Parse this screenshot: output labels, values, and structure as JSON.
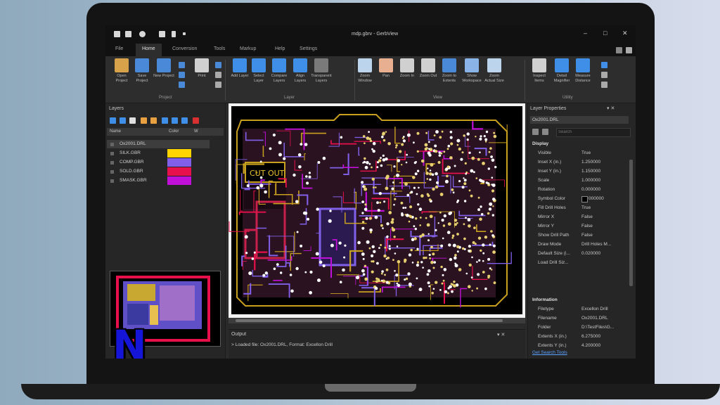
{
  "app": {
    "title": "mdp.gbrv - GerbView",
    "window_controls": [
      "–",
      "□",
      "✕"
    ]
  },
  "menu": {
    "items": [
      "File",
      "Home",
      "Conversion",
      "Tools",
      "Markup",
      "Help",
      "Settings"
    ],
    "active": "Home"
  },
  "ribbon": {
    "buttons": [
      {
        "label": "Open Project",
        "icon": "folder-open-icon",
        "color": "#d8a24a"
      },
      {
        "label": "Save Project",
        "icon": "save-icon",
        "color": "#4a88d8"
      },
      {
        "label": "New Project",
        "icon": "new-project-icon",
        "color": "#4a88d8"
      },
      {
        "label": "Print",
        "icon": "printer-icon",
        "color": "#d0d0d0"
      },
      {
        "label": "Add Layer",
        "icon": "add-layer-icon",
        "color": "#3f8ee8"
      },
      {
        "label": "Select Layer",
        "icon": "cursor-icon",
        "color": "#3f8ee8"
      },
      {
        "label": "Compare Layers",
        "icon": "compare-layers-icon",
        "color": "#3f8ee8"
      },
      {
        "label": "Align Layers",
        "icon": "align-layers-icon",
        "color": "#3f8ee8"
      },
      {
        "label": "Transparent Layers",
        "icon": "transparent-icon",
        "color": "#7a7a7a"
      },
      {
        "label": "Zoom Window",
        "icon": "zoom-window-icon",
        "color": "#bcd4ec"
      },
      {
        "label": "Pan",
        "icon": "hand-icon",
        "color": "#e8b090"
      },
      {
        "label": "Zoom In",
        "icon": "zoom-in-icon",
        "color": "#d0d0d0"
      },
      {
        "label": "Zoom Out",
        "icon": "zoom-out-icon",
        "color": "#d0d0d0"
      },
      {
        "label": "Zoom to Extents",
        "icon": "zoom-extents-icon",
        "color": "#4a88d8"
      },
      {
        "label": "Show Workspace",
        "icon": "grid-icon",
        "color": "#8ab4e8"
      },
      {
        "label": "Zoom Actual Size",
        "icon": "actual-size-icon",
        "color": "#bcd4ec"
      },
      {
        "label": "Inspect Items",
        "icon": "binoculars-icon",
        "color": "#d0d0d0"
      },
      {
        "label": "Detail Magnifier",
        "icon": "magnifier-icon",
        "color": "#3f8ee8"
      },
      {
        "label": "Measure Distance",
        "icon": "ruler-icon",
        "color": "#3f8ee8"
      }
    ],
    "groups": [
      "Project",
      "Layer",
      "View",
      "Utility"
    ]
  },
  "layers_panel": {
    "title": "Layers",
    "columns": [
      "Name",
      "Color",
      "W"
    ],
    "layers": [
      {
        "name": "Ox2001.DRL",
        "color": ""
      },
      {
        "name": "SILK.GBR",
        "color": "#ffd400"
      },
      {
        "name": "COMP.GBR",
        "color": "#8060e8"
      },
      {
        "name": "SOLD.GBR",
        "color": "#e8104a"
      },
      {
        "name": "SMASK.GBR",
        "color": "#c010d8"
      }
    ],
    "logo_letter": "N"
  },
  "output": {
    "title": "Output",
    "message": "> Loaded file: Ox2001.DRL, Format: Excellon Drill"
  },
  "properties": {
    "title": "Layer Properties",
    "file": "Ox2001.DRL",
    "search_placeholder": "Search",
    "display_category": "Display",
    "display_rows": [
      {
        "key": "Visible",
        "value": "True"
      },
      {
        "key": "Inset X (in.)",
        "value": "1.250000"
      },
      {
        "key": "Inset Y (in.)",
        "value": "1.150000"
      },
      {
        "key": "Scale",
        "value": "1.000000"
      },
      {
        "key": "Rotation",
        "value": "0.000000"
      },
      {
        "key": "Symbol Color",
        "value": "000000"
      },
      {
        "key": "Fill Drill Holes",
        "value": "True"
      },
      {
        "key": "Mirror X",
        "value": "False"
      },
      {
        "key": "Mirror Y",
        "value": "False"
      },
      {
        "key": "Show Drill Path",
        "value": "False"
      },
      {
        "key": "Draw Mode",
        "value": "Drill Holes M..."
      },
      {
        "key": "Default Size (i...",
        "value": "0.020000"
      },
      {
        "key": "Load Drill Siz...",
        "value": ""
      }
    ],
    "info_category": "Information",
    "info_rows": [
      {
        "key": "Filetype",
        "value": "Excellon Drill"
      },
      {
        "key": "Filename",
        "value": "Ox2001.DRL"
      },
      {
        "key": "Folder",
        "value": "D:\\TestFiles\\G..."
      },
      {
        "key": "Extents X (in.)",
        "value": "6.275000"
      },
      {
        "key": "Extents Y (in.)",
        "value": "4.200000"
      }
    ],
    "link": "Get Search Tools"
  }
}
